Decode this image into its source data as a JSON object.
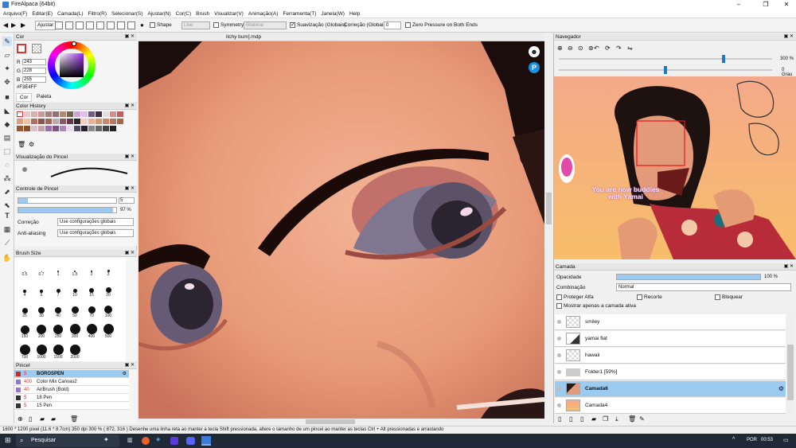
{
  "window": {
    "title": "FireAlpaca (64bit)"
  },
  "menu": [
    "Arquivo(F)",
    "Editar(E)",
    "Camada(L)",
    "Filtro(R)",
    "Selecionar(S)",
    "Ajustar(N)",
    "Cor(C)",
    "Brush",
    "Visualizar(V)",
    "Animação(A)",
    "Ferramenta(T)",
    "Janela(W)",
    "Help"
  ],
  "toolbar": {
    "ajustar": "Ajustar",
    "shape": "Shape",
    "shape_value": "Line",
    "symmetry": "Symmetry",
    "symmetry_value": "Bilateral",
    "suavizacao": "Suavização (Globais)",
    "correcao": "Correção (Globais)",
    "correcao_value": "0",
    "zero_pressure": "Zero Pressure on Both Ends"
  },
  "canvas": {
    "tab": "itchy bum].mdp"
  },
  "color": {
    "title": "Cor",
    "r_label": "R",
    "g_label": "G",
    "b_label": "B",
    "r": "243",
    "g": "228",
    "b": "255",
    "hex": "#F3E4FF",
    "tab_cor": "Cor",
    "tab_paleta": "Paleta"
  },
  "history": {
    "title": "Color History",
    "colors": [
      "#ffffff",
      "#e8c8c8",
      "#d8b0b0",
      "#c49a9a",
      "#a08080",
      "#907070",
      "#b08870",
      "#706050",
      "#c8a8d0",
      "#e0c0e8",
      "#706080",
      "#403040",
      "#e0e0e0",
      "#d09090",
      "#c06060",
      "#e0a080",
      "#f0c0a0",
      "#b07060",
      "#8a5848",
      "#a06858",
      "#c0a8b0",
      "#885868",
      "#603848",
      "#302028",
      "#f0d0c0",
      "#e8b098",
      "#d89878",
      "#c88868",
      "#b87858",
      "#a86848",
      "#985838",
      "#885030",
      "#d8c0c8",
      "#c8a0a8",
      "#9870a8",
      "#805080",
      "#a888b8",
      "#e8d8f0",
      "#504860",
      "#282030",
      "#888888",
      "#666666",
      "#444444",
      "#222222"
    ]
  },
  "brushpreview": {
    "title": "Visualização do Pincel"
  },
  "brushcontrol": {
    "title": "Controle de Pincel",
    "size": "5",
    "opacity": "97 %",
    "opacity_pct": 97,
    "correcao_label": "Correção",
    "correcao_value": "Use configurações globais",
    "aa_label": "Anti-aliasing",
    "aa_value": "Use configurações globais"
  },
  "brushsize": {
    "title": "Brush Size",
    "sizes": [
      "0.5",
      "0.7",
      "1",
      "1.5",
      "2",
      "3",
      "4",
      "5",
      "7",
      "10",
      "15",
      "20",
      "25",
      "30",
      "40",
      "50",
      "70",
      "100",
      "150",
      "200",
      "250",
      "300",
      "400",
      "500",
      "700",
      "1000",
      "1500",
      "2000"
    ]
  },
  "pincel": {
    "title": "Pincel",
    "items": [
      {
        "size": "5",
        "name": "BOROSPEN",
        "color": "#c03030"
      },
      {
        "size": "400",
        "name": "Color Mix Canvas2",
        "color": "#8878d8"
      },
      {
        "size": "40",
        "name": "AirBrush (Bold)",
        "color": "#a070d0"
      },
      {
        "size": "5",
        "name": "18 Pen",
        "color": "#333333"
      },
      {
        "size": "5",
        "name": "15 Pen",
        "color": "#333333"
      }
    ]
  },
  "navigator": {
    "title": "Navegador",
    "zoom": "300 %",
    "angle": "0 Grau",
    "bubble": "You are now buddies\nwith Yamai"
  },
  "layer": {
    "title": "Camada",
    "opacity_label": "Opacidade",
    "opacity": "100 %",
    "blend_label": "Combinação",
    "blend": "Normal",
    "protect": "Proteger Alfa",
    "clip": "Recorte",
    "lock": "Bloquear",
    "show_active": "Mostrar apenas a camada ativa",
    "layers": [
      "smiley",
      "yamai flat",
      "hawaii",
      "Folder1 [59%]",
      "Camada6",
      "Camada4"
    ]
  },
  "status": {
    "dims": "1600 * 1200 pixel",
    "size": "(11.6 * 8.7cm)",
    "dpi": "350 dpi",
    "zoom": "300 %",
    "coords": "( 872, 316 )",
    "hint": "Desenhe uma linha reta ao manter a tecla Shift pressionada, altere o tamanho de um pincel ao manter as teclas Ctrl + Alt pressionadas e arrastando"
  },
  "taskbar": {
    "search": "Pesquisar",
    "lang": "POR",
    "time": "00:53"
  },
  "colors": {
    "accent": "#9cc9ef",
    "selected": "#9ccbf2",
    "taskbar": "#1f2a36"
  }
}
